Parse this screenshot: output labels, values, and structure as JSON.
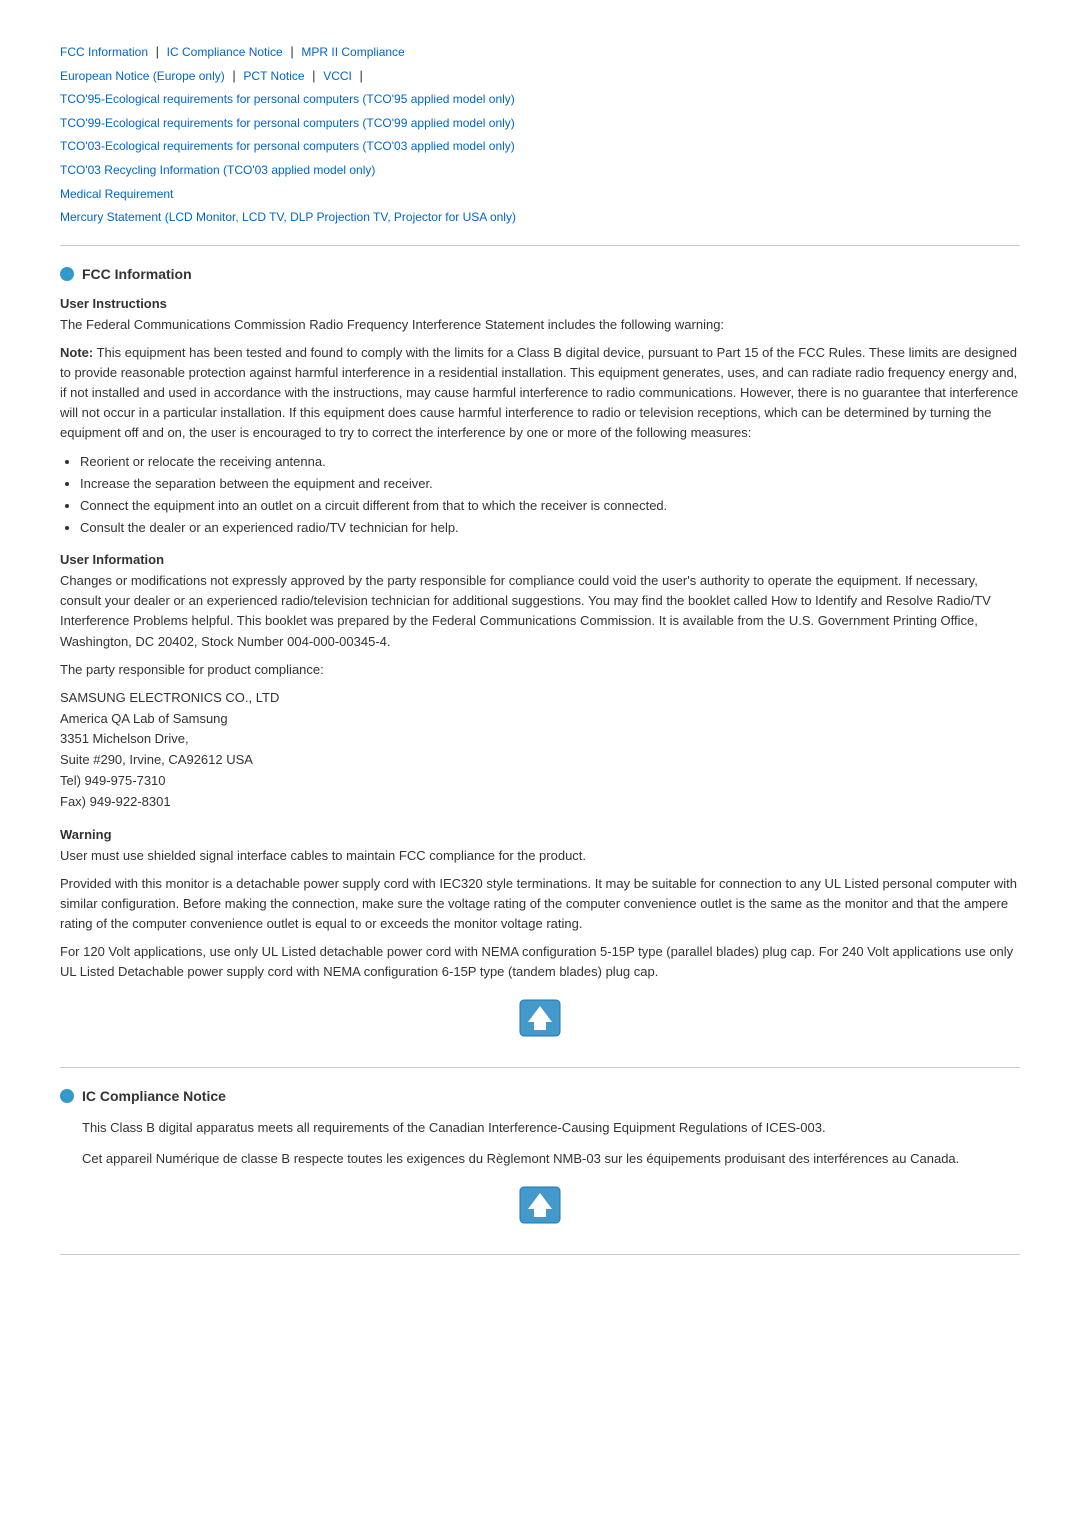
{
  "nav": {
    "links": [
      {
        "label": "FCC Information",
        "href": "#fcc"
      },
      {
        "label": "IC Compliance Notice",
        "href": "#ic"
      },
      {
        "label": "MPR II Compliance",
        "href": "#mpr"
      },
      {
        "label": "European Notice (Europe only)",
        "href": "#eu"
      },
      {
        "label": "PCT Notice",
        "href": "#pct"
      },
      {
        "label": "VCCI",
        "href": "#vcci"
      },
      {
        "label": "TCO'95-Ecological requirements for personal computers (TCO'95 applied model only)",
        "href": "#tco95"
      },
      {
        "label": "TCO'99-Ecological requirements for personal computers (TCO'99 applied model only)",
        "href": "#tco99"
      },
      {
        "label": "TCO'03-Ecological requirements for personal computers (TCO'03 applied model only)",
        "href": "#tco03"
      },
      {
        "label": "TCO'03 Recycling Information (TCO'03 applied model only)",
        "href": "#tco03r"
      },
      {
        "label": "Medical Requirement",
        "href": "#medical"
      },
      {
        "label": "Mercury Statement (LCD Monitor, LCD TV, DLP Projection TV, Projector for USA only)",
        "href": "#mercury"
      }
    ]
  },
  "fcc_section": {
    "title": "FCC Information",
    "user_instructions_title": "User Instructions",
    "user_instructions_intro": "The Federal Communications Commission Radio Frequency Interference Statement includes the following warning:",
    "note_text": "Note: This equipment has been tested and found to comply with the limits for a Class B digital device, pursuant to Part 15 of the FCC Rules. These limits are designed to provide reasonable protection against harmful interference in a residential installation. This equipment generates, uses, and can radiate radio frequency energy and, if not installed and used in accordance with the instructions, may cause harmful interference to radio communications. However, there is no guarantee that interference will not occur in a particular installation. If this equipment does cause harmful interference to radio or television receptions, which can be determined by turning the equipment off and on, the user is encouraged to try to correct the interference by one or more of the following measures:",
    "measures": [
      "Reorient or relocate the receiving antenna.",
      "Increase the separation between the equipment and receiver.",
      "Connect the equipment into an outlet on a circuit different from that to which the receiver is connected.",
      "Consult the dealer or an experienced radio/TV technician for help."
    ],
    "user_information_title": "User Information",
    "user_information_text": "Changes or modifications not expressly approved by the party responsible for compliance could void the user's authority to operate the equipment. If necessary, consult your dealer or an experienced radio/television technician for additional suggestions. You may find the booklet called How to Identify and Resolve Radio/TV Interference Problems helpful. This booklet was prepared by the Federal Communications Commission. It is available from the U.S. Government Printing Office, Washington, DC 20402, Stock Number 004-000-00345-4.",
    "party_intro": "The party responsible for product compliance:",
    "address_lines": [
      "SAMSUNG ELECTRONICS CO., LTD",
      "America QA Lab of Samsung",
      "3351 Michelson Drive,",
      "Suite #290, Irvine, CA92612 USA",
      "Tel) 949-975-7310",
      "Fax) 949-922-8301"
    ],
    "warning_title": "Warning",
    "warning_text1": "User must use shielded signal interface cables to maintain FCC compliance for the product.",
    "warning_text2": "Provided with this monitor is a detachable power supply cord with IEC320 style terminations. It may be suitable for connection to any UL Listed personal computer with similar configuration. Before making the connection, make sure the voltage rating of the computer convenience outlet is the same as the monitor and that the ampere rating of the computer convenience outlet is equal to or exceeds the monitor voltage rating.",
    "warning_text3": "For 120 Volt applications, use only UL Listed detachable power cord with NEMA configuration 5-15P type (parallel blades) plug cap. For 240 Volt applications use only UL Listed Detachable power supply cord with NEMA configuration 6-15P type (tandem blades) plug cap."
  },
  "ic_section": {
    "title": "IC Compliance Notice",
    "text1": "This Class B digital apparatus meets all requirements of the Canadian Interference-Causing Equipment Regulations of ICES-003.",
    "text2": "Cet appareil Numérique de classe B respecte toutes les exigences du Règlemont NMB-03 sur les équipements produisant des interférences au Canada."
  },
  "top_icon_alt": "Top"
}
